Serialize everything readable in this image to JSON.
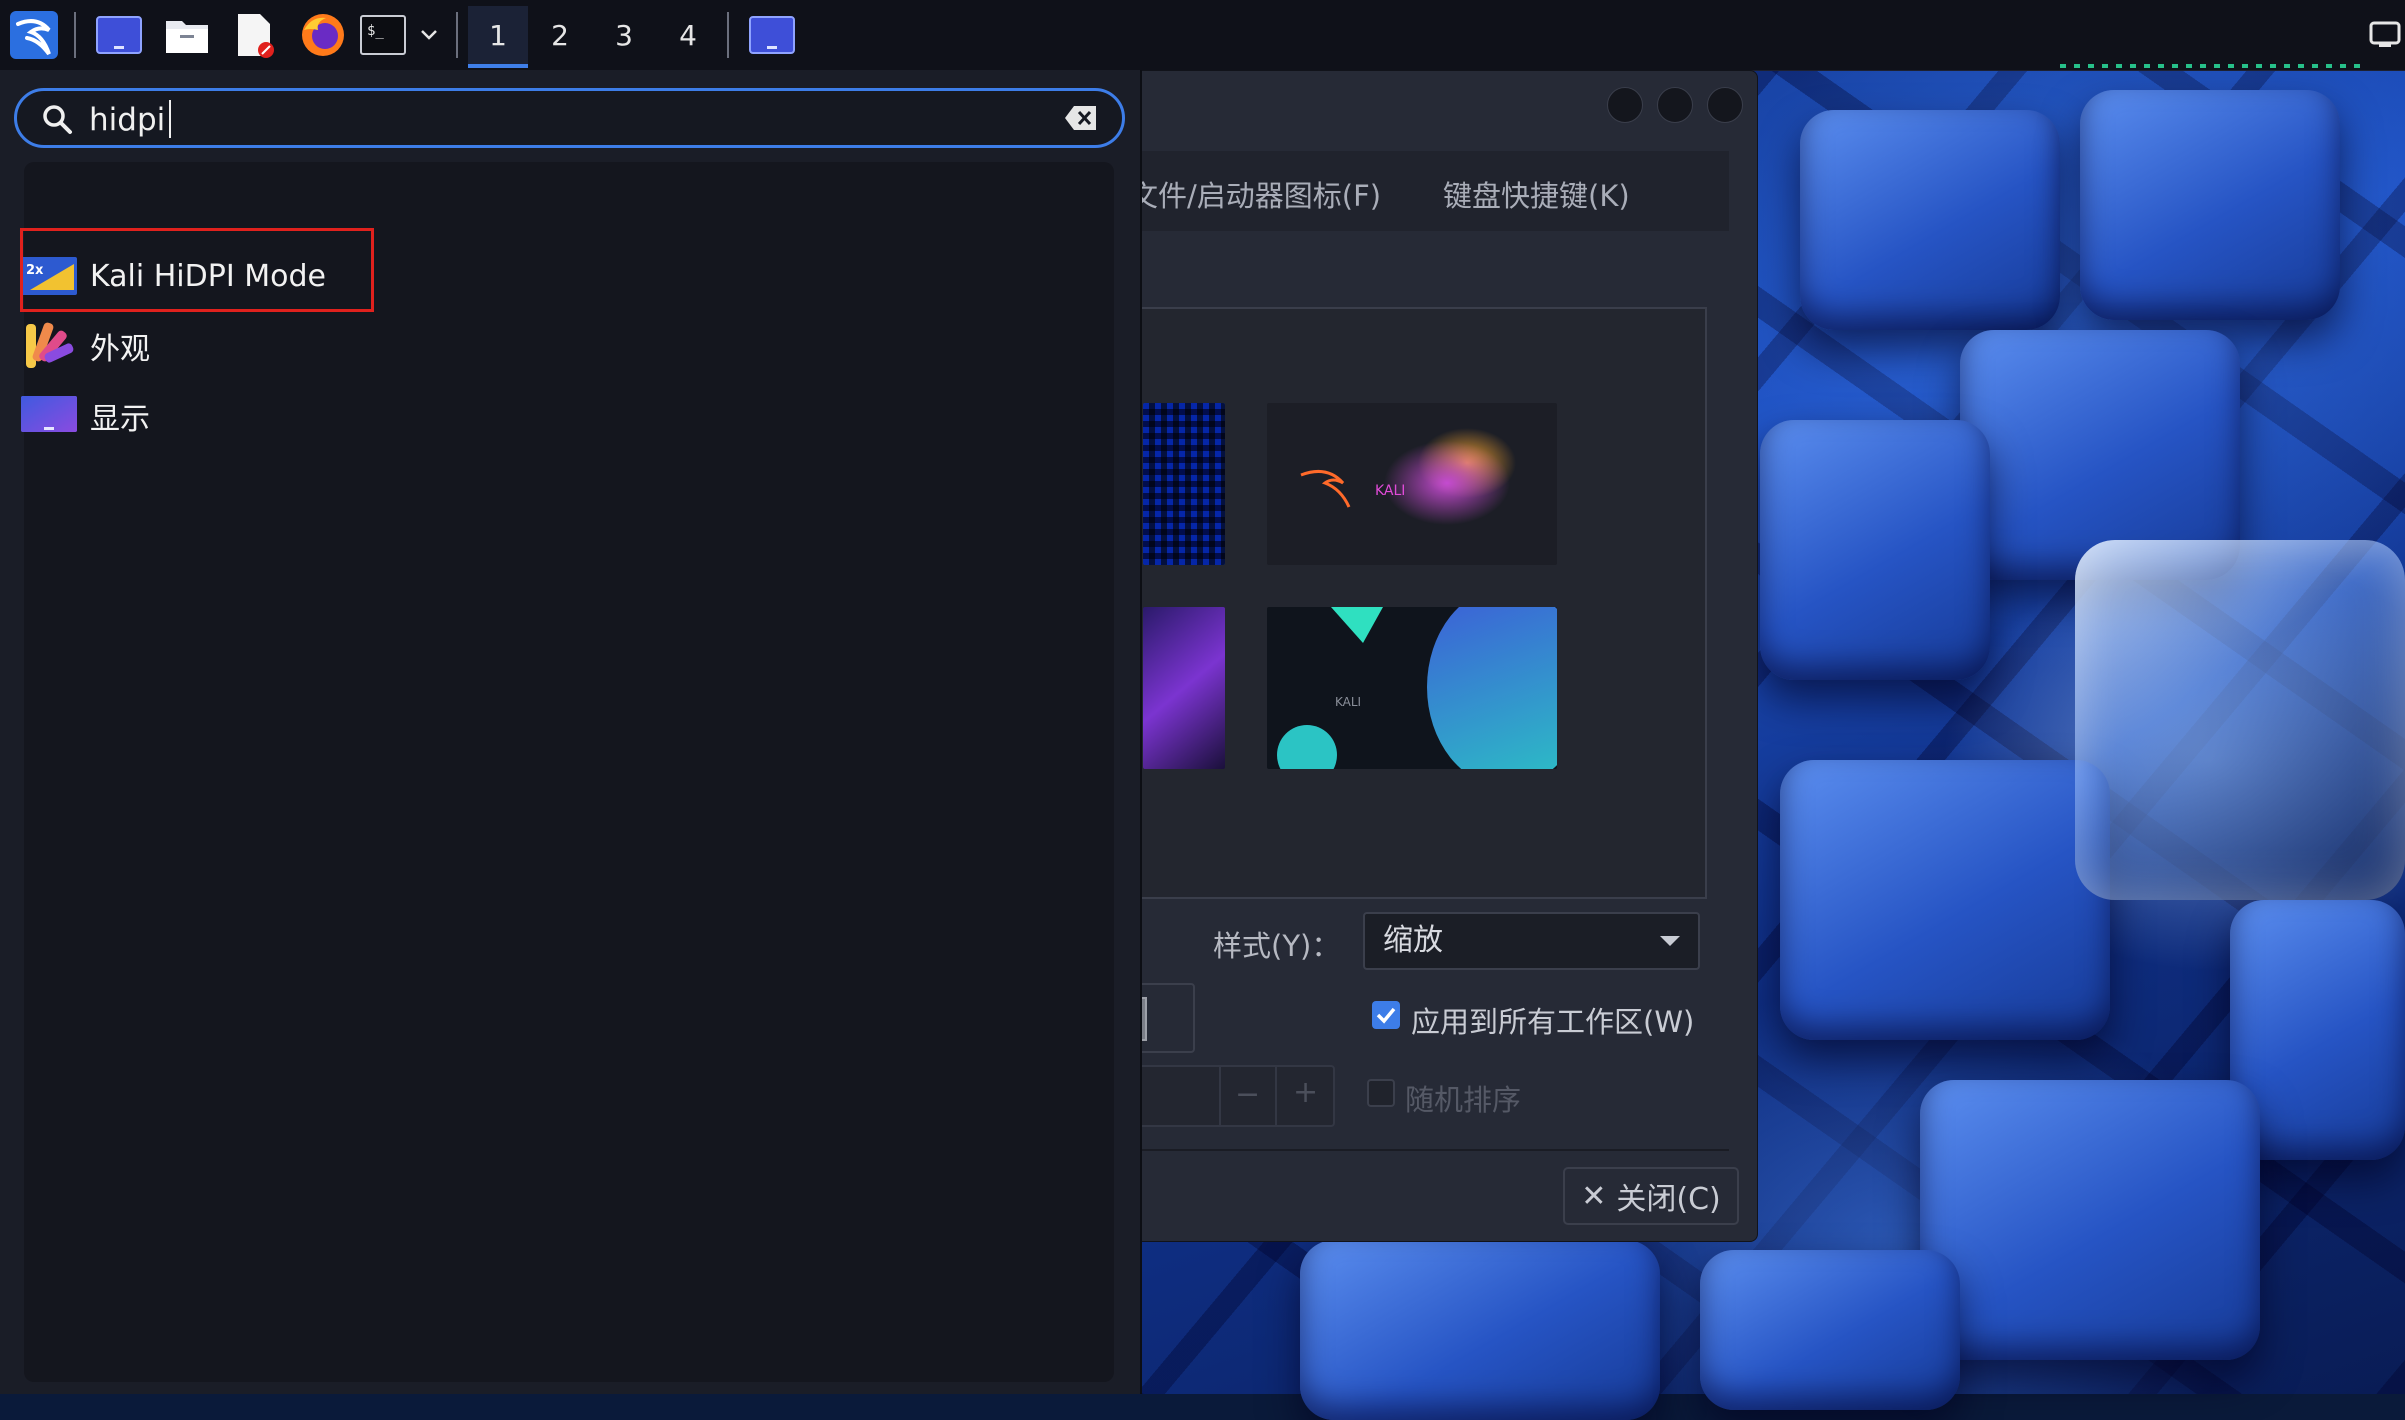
{
  "panel": {
    "workspaces": [
      "1",
      "2",
      "3",
      "4"
    ],
    "active_workspace": "1",
    "icons": [
      "kali-menu-icon",
      "display-window-icon",
      "file-manager-icon",
      "text-editor-icon",
      "firefox-icon",
      "terminal-icon",
      "terminal-dropdown-icon",
      "window-button-icon"
    ]
  },
  "finder": {
    "search_value": "hidpi",
    "results": [
      {
        "label": "Kali HiDPI Mode",
        "icon": "hidpi-mode-icon"
      },
      {
        "label": "外观",
        "icon": "appearance-icon"
      },
      {
        "label": "显示",
        "icon": "display-icon"
      }
    ]
  },
  "dialog": {
    "tabs": [
      "文件/启动器图标(F)",
      "键盘快捷键(K)"
    ],
    "style_label": "样式(Y)：",
    "style_value": "缩放",
    "apply_all_label": "应用到所有工作区(W)",
    "apply_all_checked": true,
    "random_order_label": "随机排序",
    "random_order_checked": false,
    "stepper_minus": "−",
    "stepper_plus": "+",
    "close_label": "关闭(C)",
    "close_glyph": "✕",
    "thumb_kali_text": "KALI"
  },
  "colors": {
    "accent": "#3d7de8",
    "highlight_border": "#e0211d",
    "checkbox_checked": "#3d7de8"
  }
}
